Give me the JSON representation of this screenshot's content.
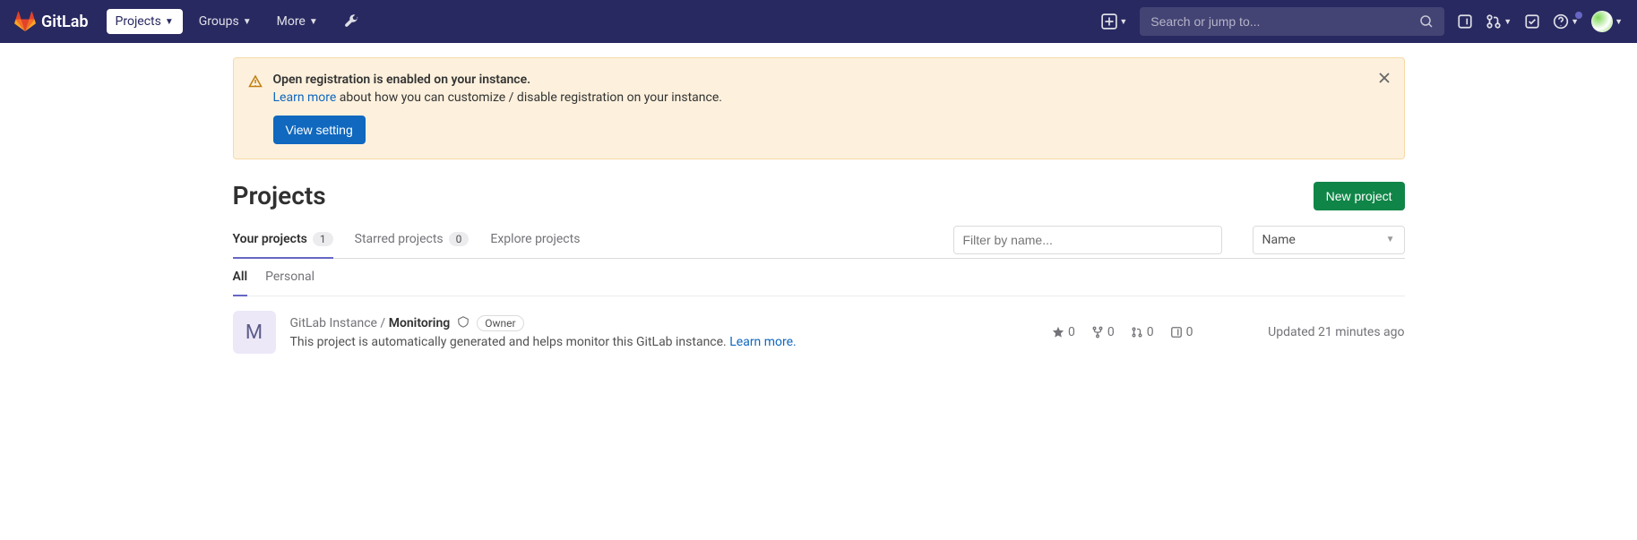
{
  "header": {
    "brand": "GitLab",
    "nav": {
      "projects": "Projects",
      "groups": "Groups",
      "more": "More"
    },
    "search_placeholder": "Search or jump to..."
  },
  "alert": {
    "title": "Open registration is enabled on your instance.",
    "link": "Learn more",
    "text": " about how you can customize / disable registration on your instance.",
    "button": "View setting"
  },
  "page": {
    "title": "Projects",
    "new_button": "New project"
  },
  "tabs": {
    "your": "Your projects",
    "your_count": "1",
    "starred": "Starred projects",
    "starred_count": "0",
    "explore": "Explore projects",
    "filter_placeholder": "Filter by name...",
    "sort": "Name"
  },
  "subtabs": {
    "all": "All",
    "personal": "Personal"
  },
  "project": {
    "avatar_letter": "M",
    "namespace": "GitLab Instance / ",
    "name": "Monitoring",
    "role": "Owner",
    "desc_pre": "This project is automatically generated and helps monitor this GitLab instance. ",
    "desc_link": "Learn more.",
    "stars": "0",
    "forks": "0",
    "mrs": "0",
    "issues": "0",
    "updated": "Updated 21 minutes ago"
  }
}
